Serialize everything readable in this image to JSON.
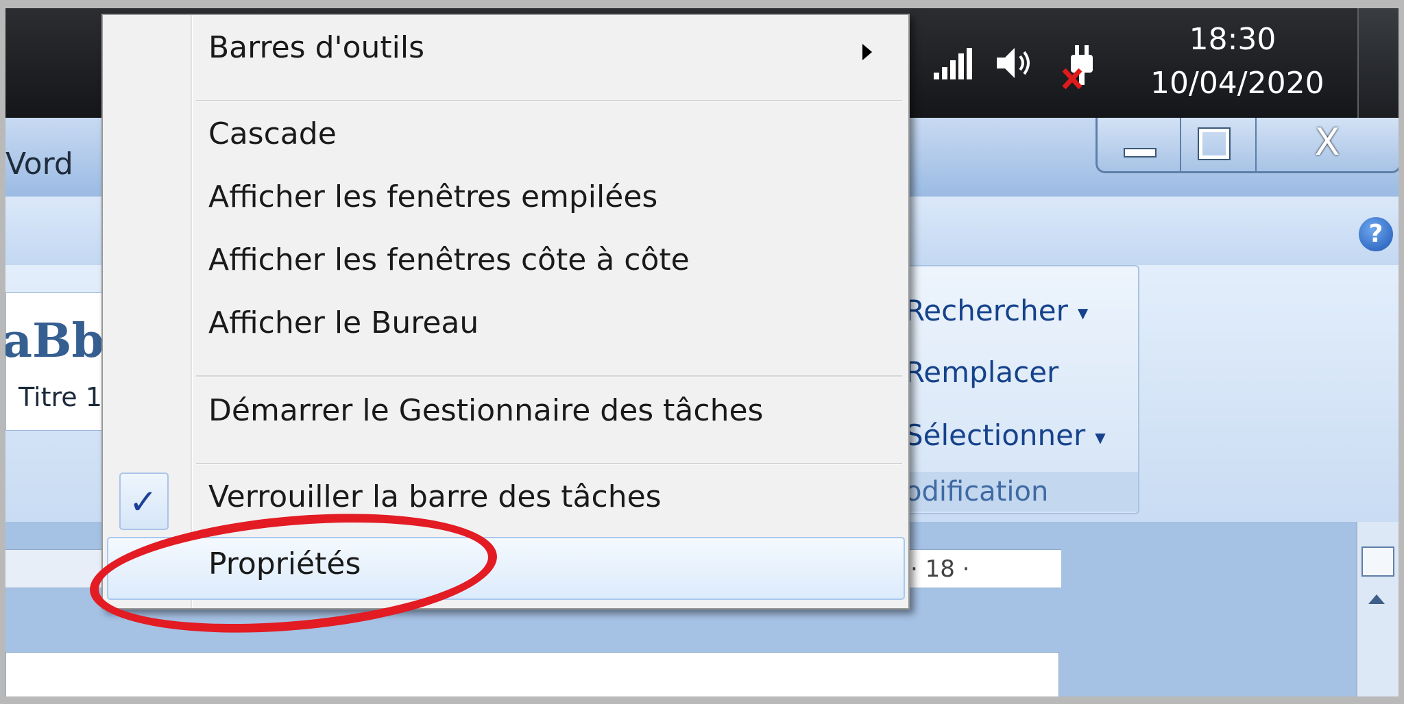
{
  "taskbar": {
    "tray": {
      "signal_icon": "signal-bars-icon",
      "volume_icon": "speaker-icon",
      "power_icon": "power-plug-error-icon"
    },
    "clock": {
      "time": "18:30",
      "date": "10/04/2020"
    }
  },
  "word": {
    "title_fragment": "Vord",
    "help_glyph": "?",
    "close_glyph": "X",
    "styles": {
      "preview": "aBb",
      "name": "Titre 1"
    },
    "editing": {
      "find": "Rechercher",
      "replace": "Remplacer",
      "select": "Sélectionner",
      "group_label": "odification"
    },
    "ruler": {
      "number": "· 18 ·"
    }
  },
  "context_menu": {
    "toolbars": "Barres d'outils",
    "cascade": "Cascade",
    "stacked": "Afficher les fenêtres empilées",
    "side_by_side": "Afficher les fenêtres côte à côte",
    "show_desktop": "Afficher le Bureau",
    "task_manager": "Démarrer le Gestionnaire des tâches",
    "lock_taskbar": "Verrouiller la barre des tâches",
    "lock_taskbar_checked": true,
    "properties": "Propriétés",
    "check_glyph": "✓"
  },
  "colors": {
    "highlight": "#e31b23",
    "menu_bg": "#f1f1f1",
    "ribbon_text": "#15428b"
  }
}
